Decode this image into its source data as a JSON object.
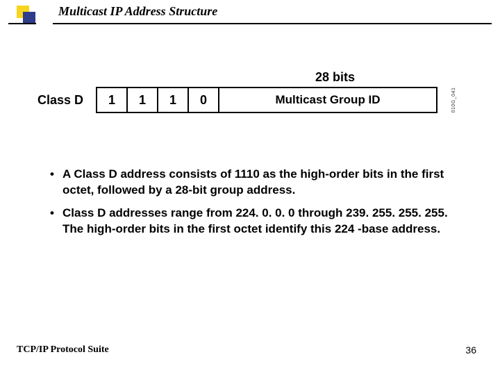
{
  "title": "Multicast IP Address Structure",
  "diagram": {
    "bits_label": "28 bits",
    "class_label": "Class D",
    "bits": [
      "1",
      "1",
      "1",
      "0"
    ],
    "group_label": "Multicast Group ID",
    "side_code": "010G_041"
  },
  "bullets": [
    "A Class D address consists of 1110 as the high-order bits in the first octet, followed by a 28-bit group address.",
    "Class D addresses range from 224. 0. 0. 0 through 239. 255. 255. 255. The high-order bits in the first octet identify this 224 -base address."
  ],
  "footer": {
    "left": "TCP/IP Protocol Suite",
    "page": "36"
  }
}
